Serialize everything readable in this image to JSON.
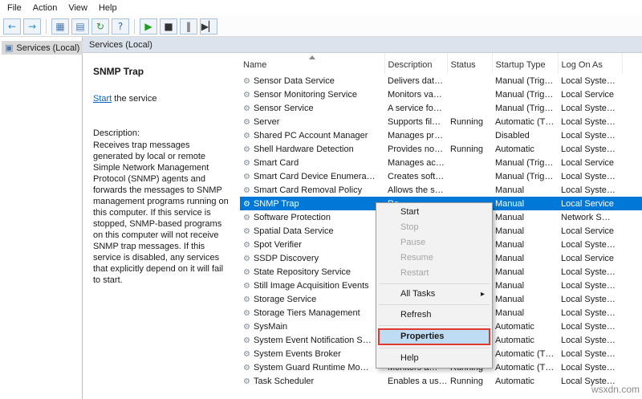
{
  "watermark": "wsxdn.com",
  "colors": {
    "accent": "#0078d7",
    "red_annotation": "#e1392d",
    "link": "#0563c1"
  },
  "menu_bar": {
    "items": [
      "File",
      "Action",
      "View",
      "Help"
    ]
  },
  "toolbar": {
    "buttons": [
      {
        "name": "back",
        "glyph": "←",
        "color": "#2b8fc0"
      },
      {
        "name": "forward",
        "glyph": "→",
        "color": "#2b8fc0"
      },
      {
        "name": "show-console-tree",
        "glyph": "▦",
        "color": "#4a78b0",
        "sep_before": true
      },
      {
        "name": "export-list",
        "glyph": "▤",
        "color": "#4a78b0"
      },
      {
        "name": "refresh",
        "glyph": "↻",
        "color": "#3c8a3c"
      },
      {
        "name": "help",
        "glyph": "?",
        "color": "#2b6cb0"
      },
      {
        "name": "start-service",
        "glyph": "▶",
        "color": "#1f9d1f",
        "sep_before": true
      },
      {
        "name": "stop-service",
        "glyph": "■",
        "color": "#333333"
      },
      {
        "name": "pause-service",
        "glyph": "‖",
        "color": "#333333"
      },
      {
        "name": "restart-service",
        "glyph": "▶▏",
        "color": "#333333"
      }
    ]
  },
  "tree": {
    "root_label": "Services (Local)",
    "icon_glyph": "▣"
  },
  "pane_header": "Services (Local)",
  "detail_panel": {
    "title": "SNMP Trap",
    "start_link": "Start",
    "start_suffix": " the service",
    "description_label": "Description:",
    "description": "Receives trap messages generated by local or remote Simple Network Management Protocol (SNMP) agents and forwards the messages to SNMP management programs running on this computer. If this service is stopped, SNMP-based programs on this computer will not receive SNMP trap messages. If this service is disabled, any services that explicitly depend on it will fail to start."
  },
  "table": {
    "columns": [
      "Name",
      "Description",
      "Status",
      "Startup Type",
      "Log On As"
    ],
    "row_icon_glyph": "⚙",
    "rows": [
      {
        "name": "Sensor Data Service",
        "description": "Delivers dat…",
        "status": "",
        "startup": "Manual (Trig…",
        "logon": "Local Syste…"
      },
      {
        "name": "Sensor Monitoring Service",
        "description": "Monitors va…",
        "status": "",
        "startup": "Manual (Trig…",
        "logon": "Local Service"
      },
      {
        "name": "Sensor Service",
        "description": "A service fo…",
        "status": "",
        "startup": "Manual (Trig…",
        "logon": "Local Syste…"
      },
      {
        "name": "Server",
        "description": "Supports fil…",
        "status": "Running",
        "startup": "Automatic (T…",
        "logon": "Local Syste…"
      },
      {
        "name": "Shared PC Account Manager",
        "description": "Manages pr…",
        "status": "",
        "startup": "Disabled",
        "logon": "Local Syste…"
      },
      {
        "name": "Shell Hardware Detection",
        "description": "Provides no…",
        "status": "Running",
        "startup": "Automatic",
        "logon": "Local Syste…"
      },
      {
        "name": "Smart Card",
        "description": "Manages ac…",
        "status": "",
        "startup": "Manual (Trig…",
        "logon": "Local Service"
      },
      {
        "name": "Smart Card Device Enumera…",
        "description": "Creates soft…",
        "status": "",
        "startup": "Manual (Trig…",
        "logon": "Local Syste…"
      },
      {
        "name": "Smart Card Removal Policy",
        "description": "Allows the s…",
        "status": "",
        "startup": "Manual",
        "logon": "Local Syste…"
      },
      {
        "name": "SNMP Trap",
        "description": "Re…",
        "status": "",
        "startup": "Manual",
        "logon": "Local Service",
        "selected": true
      },
      {
        "name": "Software Protection",
        "description": "",
        "status": "",
        "startup": "Manual",
        "logon": "Network S…"
      },
      {
        "name": "Spatial Data Service",
        "description": "",
        "status": "",
        "startup": "Manual",
        "logon": "Local Service"
      },
      {
        "name": "Spot Verifier",
        "description": "",
        "status": "",
        "startup": "Manual",
        "logon": "Local Syste…"
      },
      {
        "name": "SSDP Discovery",
        "description": "",
        "status": "",
        "startup": "Manual",
        "logon": "Local Service"
      },
      {
        "name": "State Repository Service",
        "description": "",
        "status": "",
        "startup": "Manual",
        "logon": "Local Syste…"
      },
      {
        "name": "Still Image Acquisition Events",
        "description": "",
        "status": "",
        "startup": "Manual",
        "logon": "Local Syste…"
      },
      {
        "name": "Storage Service",
        "description": "",
        "status": "",
        "startup": "Manual",
        "logon": "Local Syste…"
      },
      {
        "name": "Storage Tiers Management",
        "description": "",
        "status": "",
        "startup": "Manual",
        "logon": "Local Syste…"
      },
      {
        "name": "SysMain",
        "description": "",
        "status": "",
        "startup": "Automatic",
        "logon": "Local Syste…"
      },
      {
        "name": "System Event Notification S…",
        "description": "",
        "status": "",
        "startup": "Automatic",
        "logon": "Local Syste…"
      },
      {
        "name": "System Events Broker",
        "description": "",
        "status": "",
        "startup": "Automatic (T…",
        "logon": "Local Syste…"
      },
      {
        "name": "System Guard Runtime Mo…",
        "description": "Monitors a…",
        "status": "Running",
        "startup": "Automatic (T…",
        "logon": "Local Syste…"
      },
      {
        "name": "Task Scheduler",
        "description": "Enables a us…",
        "status": "Running",
        "startup": "Automatic",
        "logon": "Local Syste…"
      }
    ]
  },
  "context_menu": {
    "items": [
      {
        "label": "Start",
        "enabled": true
      },
      {
        "label": "Stop",
        "enabled": false
      },
      {
        "label": "Pause",
        "enabled": false
      },
      {
        "label": "Resume",
        "enabled": false
      },
      {
        "label": "Restart",
        "enabled": false
      },
      {
        "type": "separator"
      },
      {
        "label": "All Tasks",
        "enabled": true,
        "submenu": true
      },
      {
        "type": "separator"
      },
      {
        "label": "Refresh",
        "enabled": true
      },
      {
        "type": "separator"
      },
      {
        "label": "Properties",
        "enabled": true,
        "highlighted": true
      },
      {
        "type": "separator"
      },
      {
        "label": "Help",
        "enabled": true
      }
    ]
  }
}
